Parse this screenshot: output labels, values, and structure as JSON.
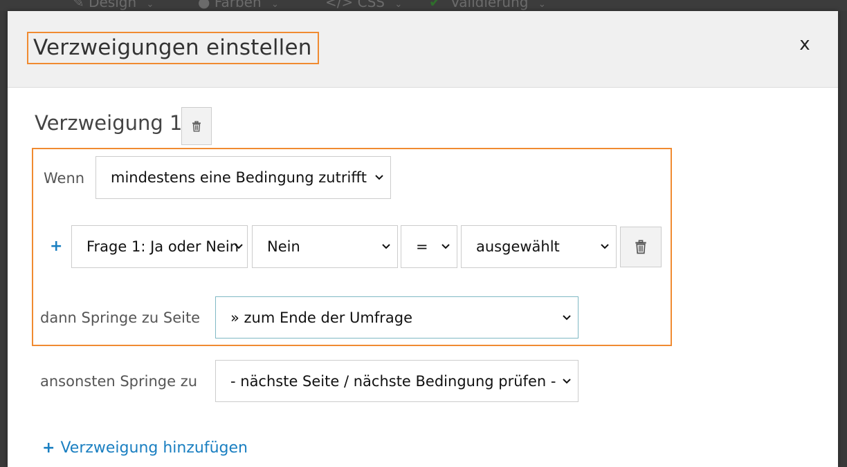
{
  "background_toolbar": {
    "items": [
      {
        "label": "Design"
      },
      {
        "label": "Farben"
      },
      {
        "label": "CSS"
      },
      {
        "label": "Validierung"
      }
    ]
  },
  "modal": {
    "title": "Verzweigungen einstellen",
    "close_label": "x"
  },
  "branch": {
    "title": "Verzweigung 1",
    "when_label": "Wenn",
    "when_select": "mindestens eine Bedingung zutrifft",
    "condition": {
      "question": "Frage 1: Ja oder Nein",
      "answer": "Nein",
      "operator": "=",
      "state": "ausgewählt"
    },
    "then_label": "dann Springe zu Seite",
    "then_select": "» zum Ende der Umfrage"
  },
  "else": {
    "label": "ansonsten Springe zu",
    "select": "- nächste Seite / nächste Bedingung prüfen -"
  },
  "add_branch_label": "Verzweigung hinzufügen",
  "colors": {
    "highlight": "#f08a30",
    "link": "#1a7fc1",
    "header_bg": "#f0f0f0"
  },
  "icons": [
    "pencil-icon",
    "palette-icon",
    "code-icon",
    "check-icon",
    "chevron-down-icon",
    "trash-icon",
    "plus-icon",
    "close-icon"
  ]
}
